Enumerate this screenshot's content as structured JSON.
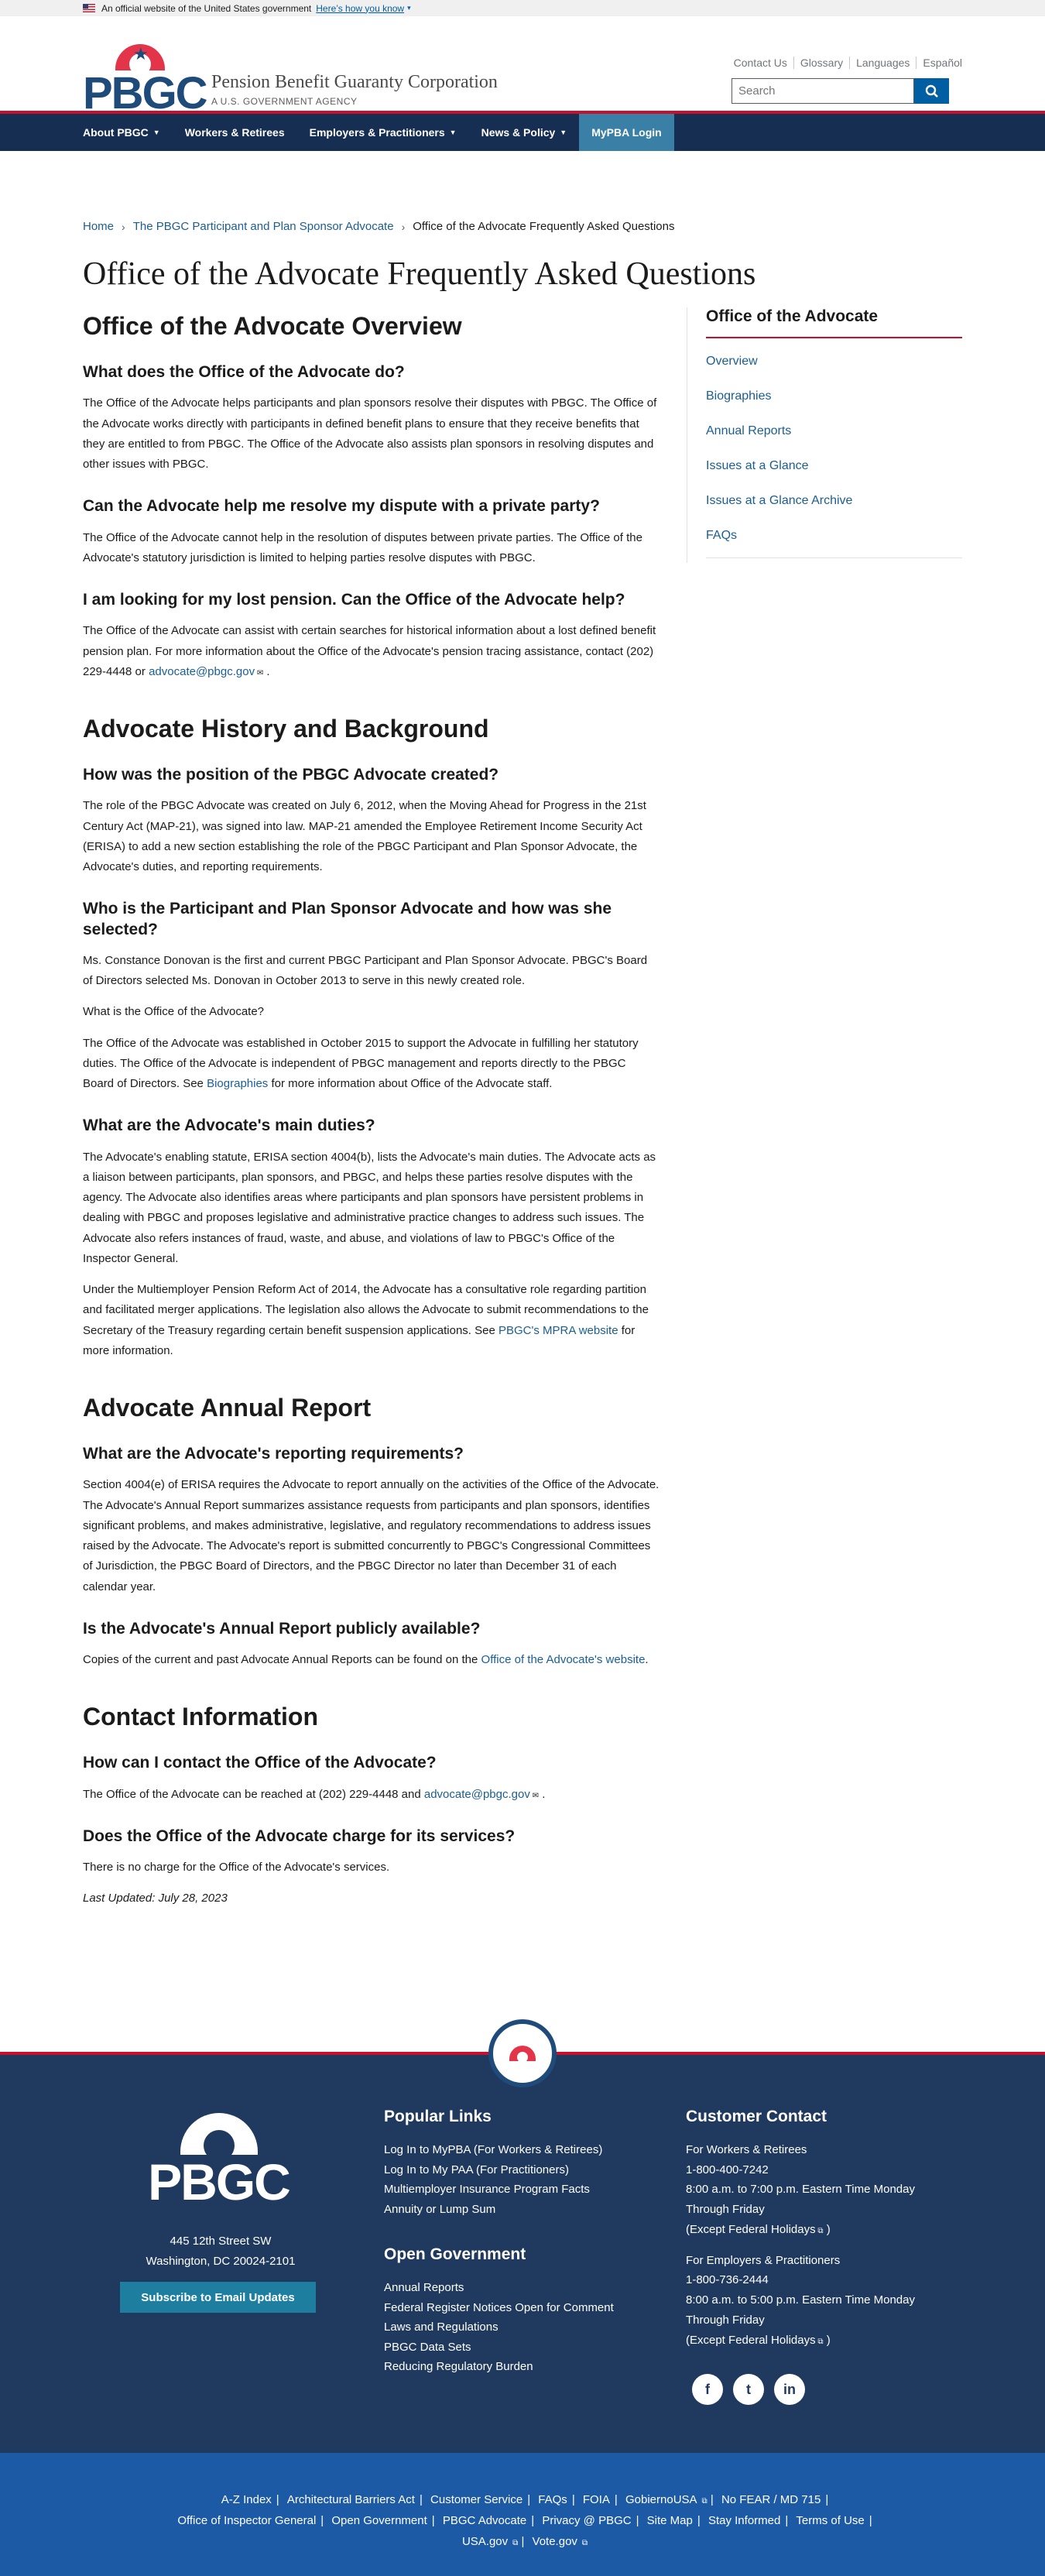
{
  "gov_banner": {
    "text": "An official website of the United States government",
    "link": "Here’s how you know"
  },
  "header": {
    "logo": "PBGC",
    "agency_name": "Pension Benefit Guaranty Corporation",
    "agency_tag": "A U.S. GOVERNMENT AGENCY",
    "utility": [
      "Contact Us",
      "Glossary",
      "Languages",
      "Español"
    ],
    "search_placeholder": "Search"
  },
  "nav": {
    "items": [
      "About PBGC",
      "Workers & Retirees",
      "Employers & Practitioners",
      "News & Policy"
    ],
    "login": "MyPBA Login"
  },
  "breadcrumb": [
    "Home",
    "The PBGC Participant and Plan Sponsor Advocate",
    "Office of the Advocate Frequently Asked Questions"
  ],
  "page_title": "Office of the Advocate Frequently Asked Questions",
  "content": {
    "s1_title": "Office of the Advocate Overview",
    "q1": "What does the Office of the Advocate do?",
    "a1": "The Office of the Advocate helps participants and plan sponsors resolve their disputes with PBGC. The Office of the Advocate works directly with participants in defined benefit plans to ensure that they receive benefits that they are entitled to from PBGC. The Office of the Advocate also assists plan sponsors in resolving disputes and other issues with PBGC.",
    "q2": "Can the Advocate help me resolve my dispute with a private party?",
    "a2": "The Office of the Advocate cannot help in the resolution of disputes between private parties. The Office of the Advocate's statutory jurisdiction is limited to helping parties resolve disputes with PBGC.",
    "q3": "I am looking for my lost pension. Can the Office of the Advocate help?",
    "a3": "The Office of the Advocate can assist with certain searches for historical information about a lost defined benefit pension plan. For more information about the Office of the Advocate's pension tracing assistance, contact (202) 229-4448 or ",
    "email": "advocate@pbgc.gov",
    "period": ".",
    "s2_title": "Advocate History and Background",
    "q4": "How was the position of the PBGC Advocate created?",
    "a4": "The role of the PBGC Advocate was created on July 6, 2012, when the Moving Ahead for Progress in the 21st Century Act (MAP-21), was signed into law. MAP-21 amended the Employee Retirement Income Security Act (ERISA) to add a new section establishing the role of the PBGC Participant and Plan Sponsor Advocate, the Advocate's duties, and reporting requirements.",
    "q5": "Who is the Participant and Plan Sponsor Advocate and how was she selected?",
    "a5": "Ms. Constance Donovan is the first and current PBGC Participant and Plan Sponsor Advocate. PBGC's Board of Directors selected Ms. Donovan in October 2013 to serve in this newly created role.",
    "a5b": "What is the Office of the Advocate?",
    "a5c": "The Office of the Advocate was established in October 2015 to support the Advocate in fulfilling her statutory duties. The Office of the Advocate is independent of PBGC management and reports directly to the PBGC Board of Directors. See ",
    "a5c_link": "Biographies",
    "a5c_end": " for more information about Office of the Advocate staff.",
    "q6": "What are the Advocate's main duties?",
    "a6": "The Advocate's enabling statute, ERISA section 4004(b), lists the Advocate's main duties. The Advocate acts as a liaison between participants, plan sponsors, and PBGC, and helps these parties resolve disputes with the agency. The Advocate also identifies areas where participants and plan sponsors have persistent problems in dealing with PBGC and proposes legislative and administrative practice changes to address such issues. The Advocate also refers instances of fraud, waste, and abuse, and violations of law to PBGC's Office of the Inspector General.",
    "a6b": "Under the Multiemployer Pension Reform Act of 2014, the Advocate has a consultative role regarding partition and facilitated merger applications. The legislation also allows the Advocate to submit recommendations to the Secretary of the Treasury regarding certain benefit suspension applications. See ",
    "a6b_link": "PBGC's MPRA website",
    "a6b_end": " for more information.",
    "s3_title": "Advocate Annual Report",
    "q7": "What are the Advocate's reporting requirements?",
    "a7": "Section 4004(e) of ERISA requires the Advocate to report annually on the activities of the Office of the Advocate. The Advocate's Annual Report summarizes assistance requests from participants and plan sponsors, identifies significant problems, and makes administrative, legislative, and regulatory recommendations to address issues raised by the Advocate. The Advocate's report is submitted concurrently to PBGC's Congressional Committees of Jurisdiction, the PBGC Board of Directors, and the PBGC Director no later than December 31 of each calendar year.",
    "q8": "Is the Advocate's Annual Report publicly available?",
    "a8": "Copies of the current and past Advocate Annual Reports can be found on the ",
    "a8_link": "Office of the Advocate's website",
    "a8_end": ".",
    "s4_title": "Contact Information",
    "q9": "How can I contact the Office of the Advocate?",
    "a9": "The Office of the Advocate can be reached at (202) 229-4448 and ",
    "q10": "Does the Office of the Advocate charge for its services?",
    "a10": "There is no charge for the Office of the Advocate's services.",
    "updated": "Last Updated: July 28, 2023"
  },
  "sidebar": {
    "title": "Office of the Advocate",
    "links": [
      "Overview",
      "Biographies",
      "Annual Reports",
      "Issues at a Glance",
      "Issues at a Glance Archive",
      "FAQs"
    ]
  },
  "footer": {
    "logo": "PBGC",
    "address1": "445 12th Street SW",
    "address2": "Washington, DC 20024-2101",
    "subscribe": "Subscribe to Email Updates",
    "popular_title": "Popular Links",
    "popular": [
      "Log In to MyPBA (For Workers & Retirees)",
      "Log In to My PAA (For Practitioners)",
      "Multiemployer Insurance Program Facts",
      "Annuity or Lump Sum"
    ],
    "open_title": "Open Government",
    "open": [
      "Annual Reports",
      "Federal Register Notices Open for Comment",
      "Laws and Regulations",
      "PBGC Data Sets",
      "Reducing Regulatory Burden"
    ],
    "contact_title": "Customer Contact",
    "workers_label": "For Workers & Retirees",
    "workers_phone": "1-800-400-7242",
    "workers_hours": "8:00 a.m. to 7:00 p.m. Eastern Time Monday Through Friday",
    "except": "(Except ",
    "holidays": "Federal Holidays",
    "close_paren": ")",
    "employers_label": "For Employers & Practitioners",
    "employers_phone": "1-800-736-2444",
    "employers_hours": "8:00 a.m. to 5:00 p.m. Eastern Time Monday Through Friday",
    "social": [
      "facebook-icon",
      "twitter-icon",
      "linkedin-icon"
    ],
    "bottom_row1": [
      "A-Z Index",
      "Architectural Barriers Act",
      "Customer Service",
      "FAQs",
      "FOIA",
      "GobiernoUSA",
      "No FEAR / MD 715"
    ],
    "bottom_row2": [
      "Office of Inspector General",
      "Open Government",
      "PBGC Advocate",
      "Privacy @ PBGC",
      "Site Map",
      "Stay Informed",
      "Terms of Use"
    ],
    "bottom_row3": [
      "USA.gov",
      "Vote.gov"
    ]
  },
  "colors": {
    "navy": "#162e51",
    "red": "#c8102e",
    "link": "#1a5e94",
    "footer": "#1f3a5e",
    "footer_bottom": "#1d5aa6"
  }
}
